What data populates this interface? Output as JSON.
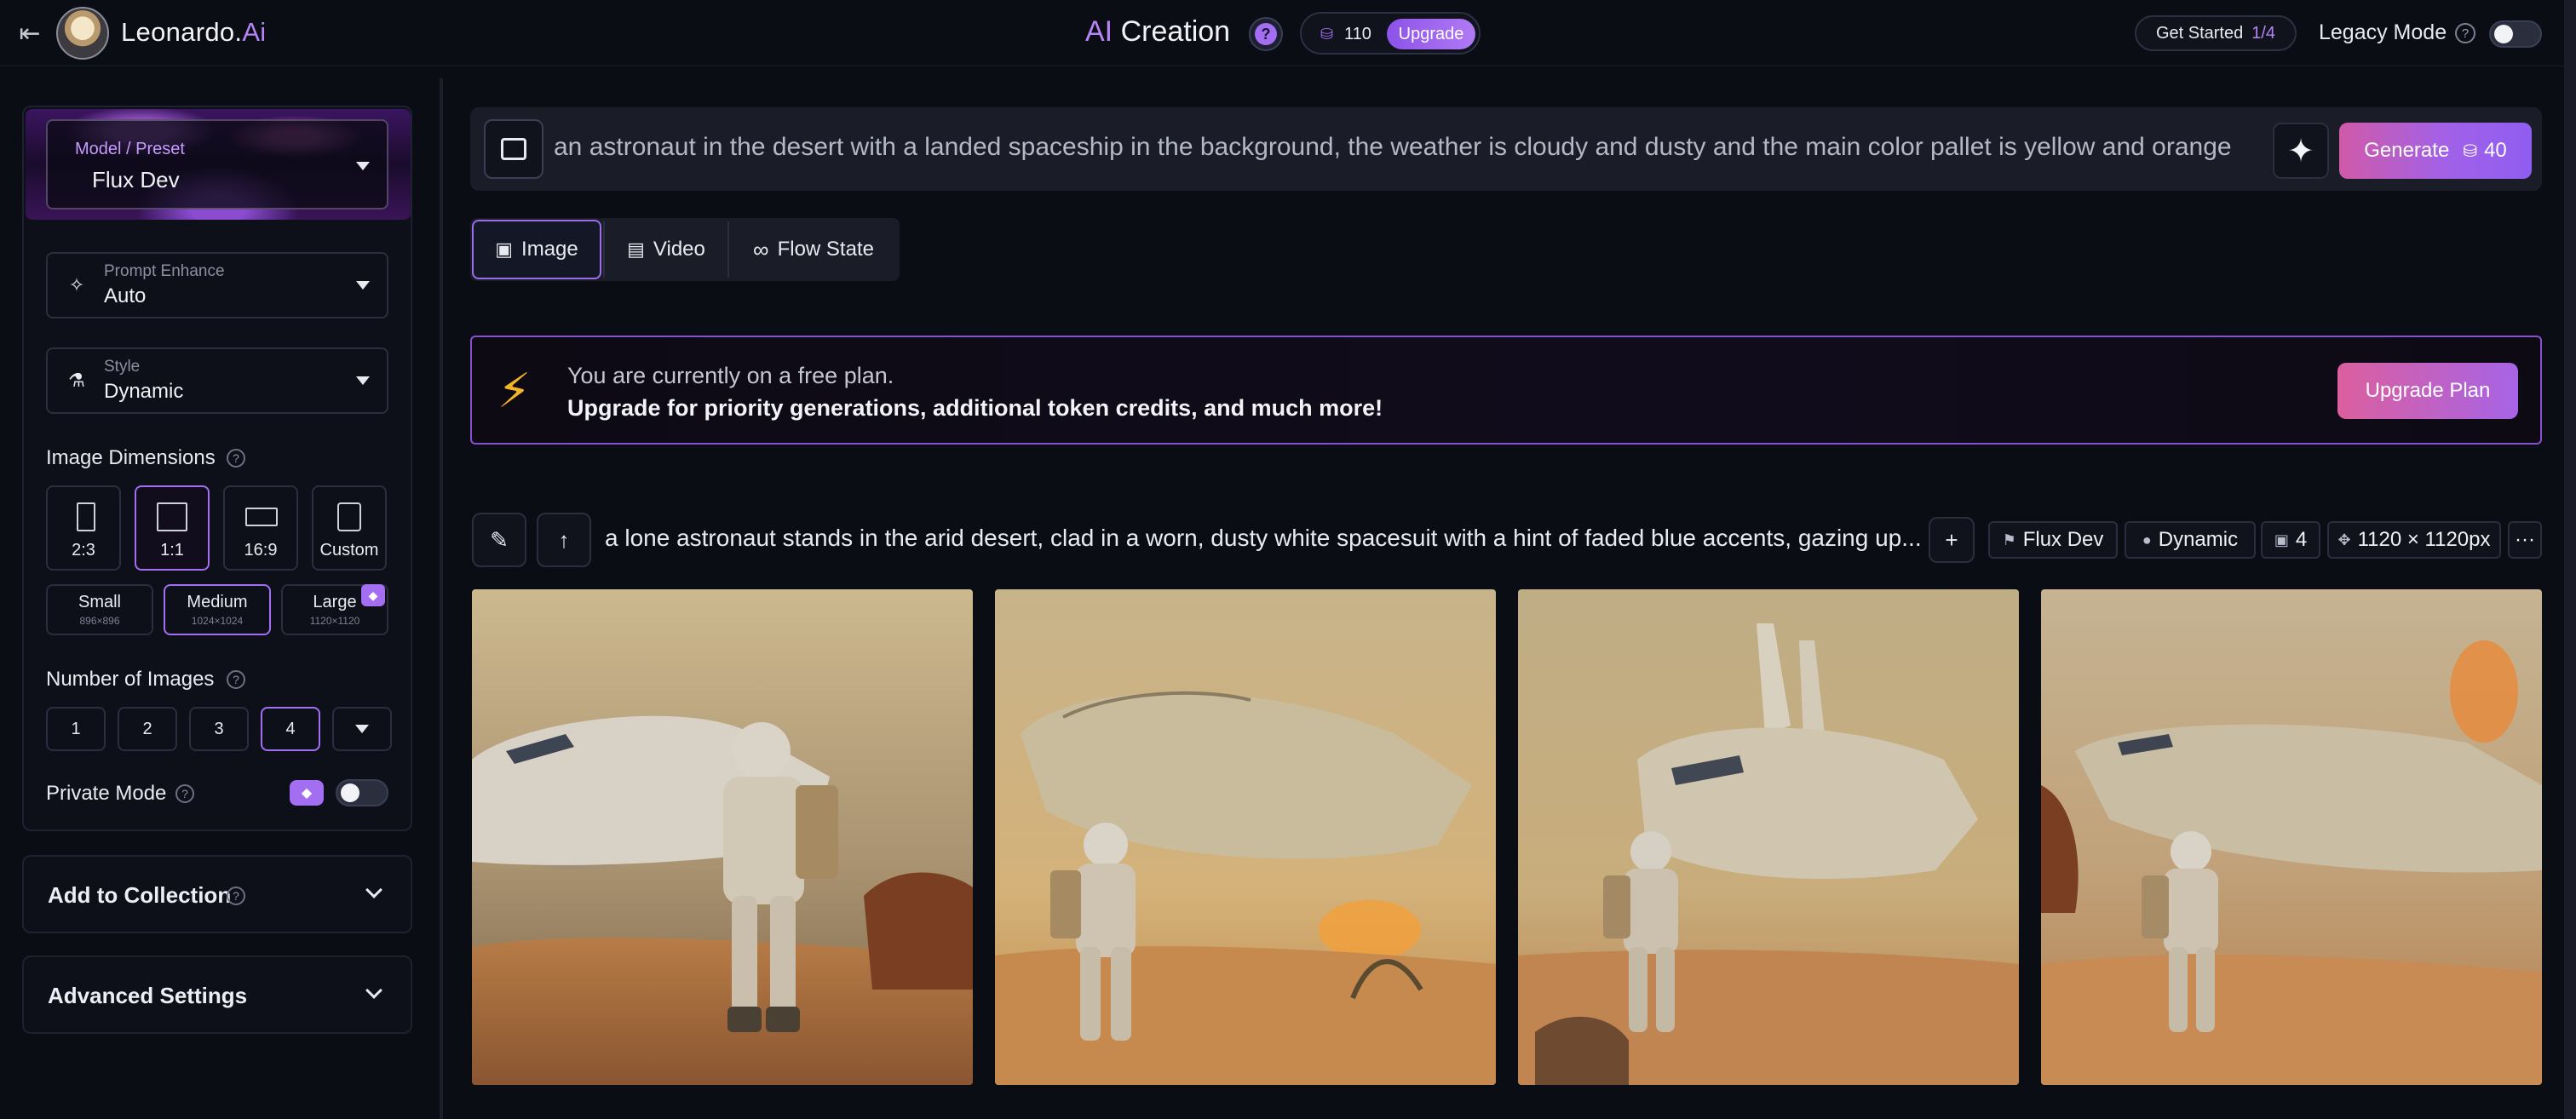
{
  "header": {
    "brand_name": "Leonardo.",
    "brand_suffix": "Ai",
    "title_accent": "AI",
    "title_rest": " Creation",
    "help_label": "?",
    "token_count": "110",
    "upgrade_label": "Upgrade",
    "get_started_label": "Get Started",
    "get_started_progress": "1/4",
    "legacy_mode_label": "Legacy Mode",
    "legacy_mode_on": false
  },
  "sidebar": {
    "model": {
      "label": "Model / Preset",
      "value": "Flux Dev"
    },
    "prompt_enhance": {
      "label": "Prompt Enhance",
      "value": "Auto"
    },
    "style": {
      "label": "Style",
      "value": "Dynamic"
    },
    "image_dimensions": {
      "label": "Image Dimensions",
      "ratios": [
        {
          "label": "2:3",
          "active": false
        },
        {
          "label": "1:1",
          "active": true
        },
        {
          "label": "16:9",
          "active": false
        },
        {
          "label": "Custom",
          "active": false
        }
      ],
      "sizes": [
        {
          "name": "Small",
          "dims": "896×896",
          "active": false
        },
        {
          "name": "Medium",
          "dims": "1024×1024",
          "active": true
        },
        {
          "name": "Large",
          "dims": "1120×1120",
          "active": false
        }
      ]
    },
    "number_of_images": {
      "label": "Number of Images",
      "options": [
        "1",
        "2",
        "3",
        "4"
      ],
      "selected": "4"
    },
    "private_mode": {
      "label": "Private Mode",
      "on": false
    },
    "add_to_collection_label": "Add to Collection",
    "advanced_settings_label": "Advanced Settings"
  },
  "main": {
    "prompt_text": "an astronaut in the desert with a landed spaceship in the background, the weather is cloudy and dusty and the main  color pallet is yellow and orange",
    "generate_label": "Generate",
    "generate_cost": "40",
    "tabs": [
      {
        "label": "Image",
        "active": true
      },
      {
        "label": "Video",
        "active": false
      },
      {
        "label": "Flow State",
        "active": false
      }
    ],
    "promo": {
      "line1": "You are currently on a free plan.",
      "line2": "Upgrade for priority generations, additional token credits, and much more!",
      "button_label": "Upgrade Plan"
    },
    "generation": {
      "prompt": "a lone astronaut stands in the arid desert, clad in a worn, dusty white spacesuit with a hint of faded blue accents, gazing up...",
      "model": "Flux Dev",
      "style": "Dynamic",
      "count": "4",
      "size": "1120 × 1120px",
      "more_label": "···"
    }
  },
  "colors": {
    "accent_purple": "#a36ef2",
    "bolt_yellow": "#f2b428",
    "background": "#0b0d14"
  }
}
